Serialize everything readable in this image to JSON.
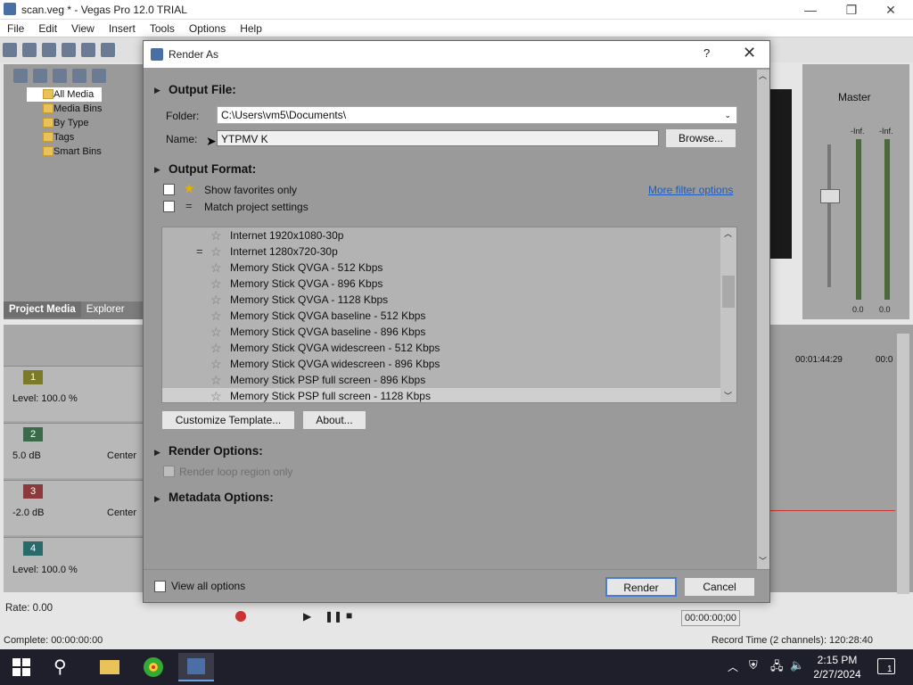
{
  "window": {
    "title": "scan.veg * - Vegas Pro 12.0 TRIAL",
    "minimize": "—",
    "maximize": "❐",
    "close": "✕"
  },
  "menu": [
    "File",
    "Edit",
    "View",
    "Insert",
    "Tools",
    "Options",
    "Help"
  ],
  "media_panel": {
    "tree": [
      "All Media",
      "Media Bins",
      "By Type",
      "Tags",
      "Smart Bins"
    ],
    "tabs": [
      "Project Media",
      "Explorer"
    ],
    "time_partial": "00"
  },
  "tracks": [
    {
      "num": "1",
      "level": "Level: 100.0 %",
      "pan": "",
      "color": "#7a7a2a"
    },
    {
      "num": "2",
      "level": "5.0 dB",
      "pan": "Center",
      "color": "#3a6a4a"
    },
    {
      "num": "3",
      "level": "-2.0 dB",
      "pan": "Center",
      "color": "#8a3a3a"
    },
    {
      "num": "4",
      "level": "Level: 100.0 %",
      "pan": "",
      "color": "#2a6a6a"
    }
  ],
  "rate": "Rate: 0.00",
  "complete": "Complete: 00:00:00:00",
  "mixer": {
    "label": "Master",
    "scale": [
      "-Inf.",
      "-Inf."
    ],
    "bottom": [
      "0.0",
      "0.0"
    ]
  },
  "timeline": {
    "tc1": "00:01:44:29",
    "tc2": "00:0"
  },
  "transport": {
    "timecode": "00:00:00;00",
    "record_time": "Record Time (2 channels): 120:28:40"
  },
  "dialog": {
    "title": "Render As",
    "help": "?",
    "close": "✕",
    "output_file": "Output File:",
    "folder_label": "Folder:",
    "folder_value": "C:\\Users\\vm5\\Documents\\",
    "name_label": "Name:",
    "name_value": "YTPMV K",
    "browse": "Browse...",
    "output_format": "Output Format:",
    "show_favorites": "Show favorites only",
    "match_project": "Match project settings",
    "more_filter": "More filter options",
    "templates": [
      {
        "name": "Internet 1920x1080-30p",
        "eq": false,
        "selected": false
      },
      {
        "name": "Internet 1280x720-30p",
        "eq": true,
        "selected": false
      },
      {
        "name": "Memory Stick QVGA - 512 Kbps",
        "eq": false,
        "selected": false
      },
      {
        "name": "Memory Stick QVGA - 896 Kbps",
        "eq": false,
        "selected": false
      },
      {
        "name": "Memory Stick QVGA - 1128 Kbps",
        "eq": false,
        "selected": false
      },
      {
        "name": "Memory Stick QVGA baseline - 512 Kbps",
        "eq": false,
        "selected": false
      },
      {
        "name": "Memory Stick QVGA baseline - 896 Kbps",
        "eq": false,
        "selected": false
      },
      {
        "name": "Memory Stick QVGA widescreen - 512 Kbps",
        "eq": false,
        "selected": false
      },
      {
        "name": "Memory Stick QVGA widescreen - 896 Kbps",
        "eq": false,
        "selected": false
      },
      {
        "name": "Memory Stick PSP full screen - 896 Kbps",
        "eq": false,
        "selected": false
      },
      {
        "name": "Memory Stick PSP full screen - 1128 Kbps",
        "eq": false,
        "selected": true
      }
    ],
    "customize": "Customize Template...",
    "about": "About...",
    "render_options": "Render Options:",
    "render_loop": "Render loop region only",
    "metadata_options": "Metadata Options:",
    "view_all": "View all options",
    "render_btn": "Render",
    "cancel_btn": "Cancel"
  },
  "taskbar": {
    "time": "2:15 PM",
    "date": "2/27/2024",
    "notifications": "1"
  }
}
